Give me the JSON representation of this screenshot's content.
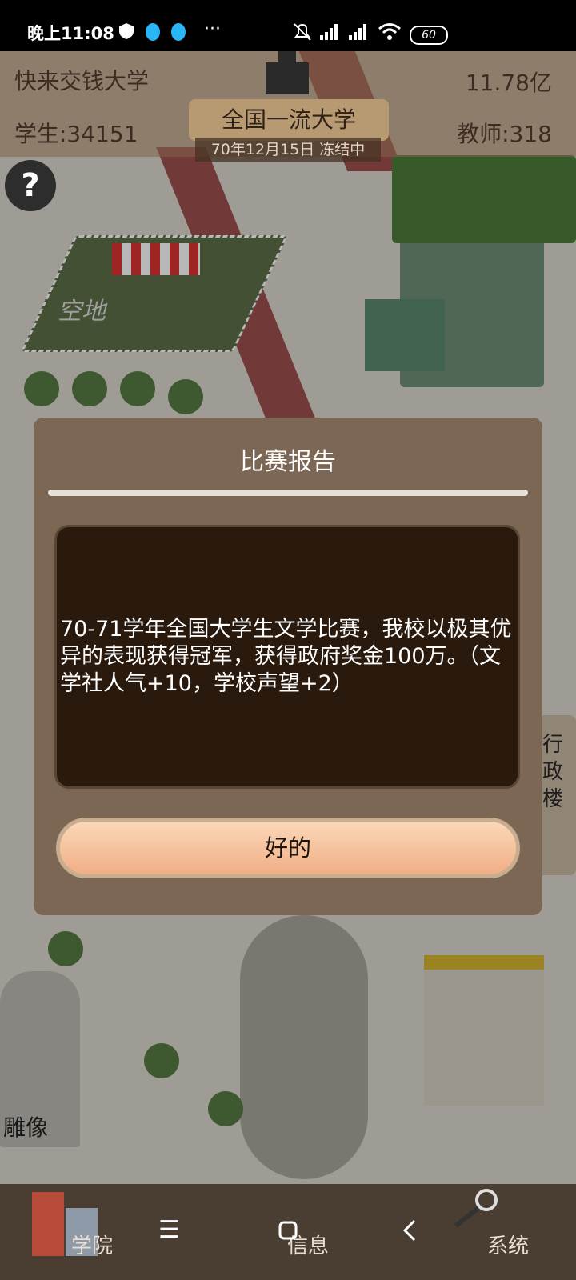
{
  "status_bar": {
    "time": "晚上11:08",
    "battery": "60"
  },
  "hud": {
    "school_name": "快来交钱大学",
    "money": "11.78亿",
    "students": "学生:34151",
    "teachers": "教师:318",
    "rank": "全国一流大学",
    "date_status": "70年12月15日 冻结中"
  },
  "map_labels": {
    "empty_lot": "空地",
    "statue": "雕像",
    "admin_building": "行政楼"
  },
  "dialog": {
    "title": "比赛报告",
    "message": "70-71学年全国大学生文学比赛，我校以极其优异的表现获得冠军，获得政府奖金100万。（文学社人气+10，学校声望+2）",
    "ok_label": "好的"
  },
  "bottom_tabs": {
    "college": "学院",
    "info": "信息",
    "system": "系统"
  },
  "icons": [
    "help-icon",
    "notification-icon",
    "signal-icon",
    "wifi-icon",
    "battery-icon",
    "menu-icon",
    "home-icon",
    "back-icon"
  ],
  "colors": {
    "dialog_bg": "#7b6754",
    "message_bg": "#2a1a0e",
    "button": "#f0ae86"
  }
}
